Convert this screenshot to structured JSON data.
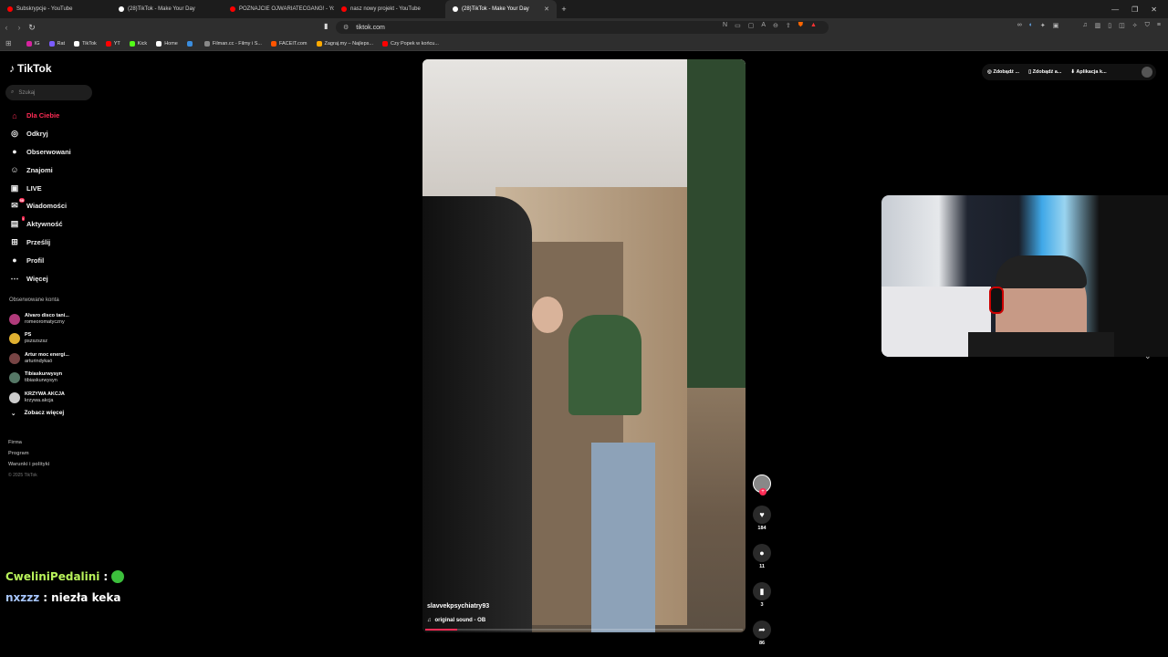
{
  "tabs": [
    {
      "title": "Subskrypcje - YouTube",
      "fav": "#ff0000"
    },
    {
      "title": "(28)TikTok - Make Your Day",
      "fav": "#ffffff"
    },
    {
      "title": "POZNAJCIE OJWARIATECGANG! - Yo",
      "fav": "#ff0000"
    },
    {
      "title": "nasz nowy projekt - YouTube",
      "fav": "#ff0000"
    },
    {
      "title": "(28)TikTok - Make Your Day",
      "fav": "#ffffff",
      "active": true
    }
  ],
  "address": {
    "url": "tiktok.com"
  },
  "bookmarks": [
    {
      "label": "IG",
      "color": "#d6249f"
    },
    {
      "label": "Rat",
      "color": "#7b5cff"
    },
    {
      "label": "TikTok",
      "color": "#ffffff"
    },
    {
      "label": "YT",
      "color": "#ff0000"
    },
    {
      "label": "Kick",
      "color": "#53fc18"
    },
    {
      "label": "Home",
      "color": "#ffffff"
    },
    {
      "label": "",
      "color": "#3a8dde"
    },
    {
      "label": "Filman.cc - Filmy i S...",
      "color": "#888888"
    },
    {
      "label": "FACEIT.com",
      "color": "#ff5500"
    },
    {
      "label": "Zagraj.my – Najleps...",
      "color": "#ffaa00"
    },
    {
      "label": "Czy Popek w końcu...",
      "color": "#ff0000"
    }
  ],
  "sidebar": {
    "logo": "TikTok",
    "search_placeholder": "Szukaj",
    "nav": [
      {
        "label": "Dla Ciebie",
        "icon": "home-icon",
        "glyph": "⌂",
        "active": true
      },
      {
        "label": "Odkryj",
        "icon": "compass-icon",
        "glyph": "◎"
      },
      {
        "label": "Obserwowani",
        "icon": "following-icon",
        "glyph": "●"
      },
      {
        "label": "Znajomi",
        "icon": "friends-icon",
        "glyph": "☺"
      },
      {
        "label": "LIVE",
        "icon": "live-icon",
        "glyph": "▣"
      },
      {
        "label": "Wiadomości",
        "icon": "messages-icon",
        "glyph": "✉",
        "badge": "58"
      },
      {
        "label": "Aktywność",
        "icon": "activity-icon",
        "glyph": "▤",
        "badge": "•"
      },
      {
        "label": "Prześlij",
        "icon": "upload-icon",
        "glyph": "⊞"
      },
      {
        "label": "Profil",
        "icon": "profile-icon",
        "glyph": "●"
      },
      {
        "label": "Więcej",
        "icon": "more-icon",
        "glyph": "⋯"
      }
    ],
    "followed_title": "Obserwowane konta",
    "followed": [
      {
        "name": "Alvaro disco tani...",
        "handle": "romeoromatyczny",
        "color": "#b03a7a"
      },
      {
        "name": "PS",
        "handle": "pszszszsz",
        "color": "#e0b030"
      },
      {
        "name": "Artur moc energi...",
        "handle": "arturindykaó",
        "color": "#774444"
      },
      {
        "name": "Tibiaskurwysyn",
        "handle": "tibiaskurwysyn",
        "color": "#557766"
      },
      {
        "name": "KRZYWA AKCJA",
        "handle": "krzywa.akcja",
        "color": "#cccccc"
      }
    ],
    "see_more": "Zobacz więcej",
    "footer": {
      "links": [
        "Firma",
        "Program",
        "Warunki i polityki"
      ],
      "copyright": "© 2025 TikTok"
    }
  },
  "topright": {
    "items": [
      "Zdobądź ...",
      "Zdobądź a...",
      "Aplikacja k..."
    ]
  },
  "video": {
    "username": "slavvekpsychiatry93",
    "sound": "original sound - OB",
    "progress": 0.1
  },
  "actions": {
    "likes": "184",
    "comments": "11",
    "saves": "3",
    "shares": "86"
  },
  "chat": [
    {
      "user": "CweliniPedalini",
      "message": "",
      "emote": "pepe-emote"
    },
    {
      "user": "nxzzz",
      "message": "niezła keka"
    }
  ]
}
